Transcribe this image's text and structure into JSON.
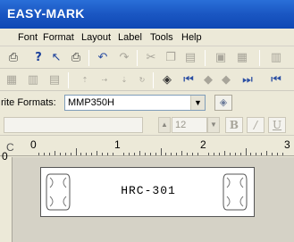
{
  "app": {
    "title": "EASY-MARK"
  },
  "menu": {
    "items": [
      "Font",
      "Format",
      "Layout",
      "Label",
      "Tools",
      "Help"
    ]
  },
  "toolbar1": {
    "icons": [
      "printer-icon",
      "help-icon",
      "context-help-icon",
      "print-preview-icon",
      "undo-icon",
      "redo-icon",
      "cut-icon",
      "copy-icon",
      "paste-icon",
      "clipboard-icon",
      "copy-format-icon",
      "more-icon"
    ]
  },
  "toolbar2": {
    "icons": [
      "grid-icon",
      "table-icon",
      "merge-icon",
      "align-icon",
      "align-right-icon",
      "align-bottom-icon",
      "rotate-icon",
      "label-icon",
      "first-icon",
      "prev-icon",
      "next-icon",
      "last-icon",
      "end-icon"
    ]
  },
  "format_bar": {
    "label": "rite Formats:",
    "value": "MMP350H"
  },
  "font_bar": {
    "size": "12",
    "bold": "B",
    "italic": "/",
    "underline": "U"
  },
  "ruler": {
    "corner": "C",
    "marks": [
      "0",
      "1",
      "2",
      "3"
    ]
  },
  "vertical_ruler": {
    "mark": "0"
  },
  "label": {
    "text": "HRC-301"
  }
}
